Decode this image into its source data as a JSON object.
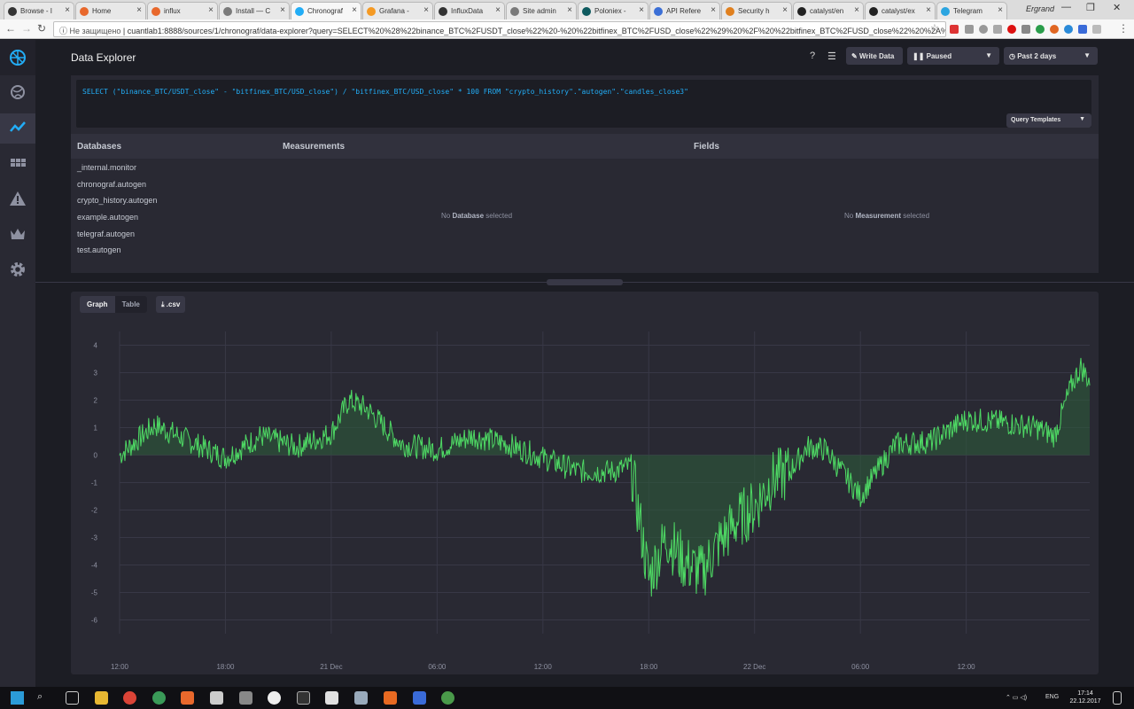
{
  "browser": {
    "tabs": [
      {
        "label": "Browse - I",
        "color": "#333333"
      },
      {
        "label": "Home",
        "color": "#e8682c"
      },
      {
        "label": "influx",
        "color": "#e8682c"
      },
      {
        "label": "Install — C",
        "color": "#7a7a7a"
      },
      {
        "label": "Chronograf",
        "color": "#22adf6"
      },
      {
        "label": "Grafana -",
        "color": "#f59a23"
      },
      {
        "label": "InfluxData",
        "color": "#333333"
      },
      {
        "label": "Site admin",
        "color": "#7a7a7a"
      },
      {
        "label": "Poloniex -",
        "color": "#0e5a5f"
      },
      {
        "label": "API Refere",
        "color": "#3b6fd6"
      },
      {
        "label": "Security h",
        "color": "#e0801f"
      },
      {
        "label": "catalyst/en",
        "color": "#222222"
      },
      {
        "label": "catalyst/ex",
        "color": "#222222"
      },
      {
        "label": "Telegram",
        "color": "#2ca5e0"
      }
    ],
    "active_tab": 4,
    "profile": "Ergrand",
    "url_security": "Не защищено",
    "url": "cuantlab1:8888/sources/1/chronograf/data-explorer?query=SELECT%20%28%22binance_BTC%2FUSDT_close%22%20-%20%22bitfinex_BTC%2FUSD_close%22%29%20%2F%20%22bitfinex_BTC%2FUSD_close%22%20%2A%20100%20FR..."
  },
  "header": {
    "title": "Data Explorer",
    "write_data_label": "Write Data",
    "paused_label": "Paused",
    "range_label": "Past 2 days"
  },
  "query": {
    "text": "SELECT (\"binance_BTC/USDT_close\" - \"bitfinex_BTC/USD_close\") / \"bitfinex_BTC/USD_close\" * 100 FROM \"crypto_history\".\"autogen\".\"candles_close3\"",
    "templates_label": "Query Templates"
  },
  "schema": {
    "databases_header": "Databases",
    "measurements_header": "Measurements",
    "fields_header": "Fields",
    "databases": [
      "_internal.monitor",
      "chronograf.autogen",
      "crypto_history.autogen",
      "example.autogen",
      "telegraf.autogen",
      "test.autogen"
    ],
    "measurements_empty_pre": "No ",
    "measurements_empty_bold": "Database",
    "measurements_empty_post": " selected",
    "fields_empty_pre": "No ",
    "fields_empty_bold": "Measurement",
    "fields_empty_post": " selected"
  },
  "graph_controls": {
    "graph_label": "Graph",
    "table_label": "Table",
    "csv_label": ".csv"
  },
  "chart_data": {
    "type": "area",
    "ylim": [
      -6.5,
      4.5
    ],
    "yticks": [
      4,
      3,
      2,
      1,
      0,
      -1,
      -2,
      -3,
      -4,
      -5,
      -6
    ],
    "xticks": [
      "12:00",
      "18:00",
      "21 Dec",
      "06:00",
      "12:00",
      "18:00",
      "22 Dec",
      "06:00",
      "12:00"
    ],
    "x_hours": [
      0,
      55
    ],
    "series": [
      {
        "color": "#4ed964",
        "fill": "#2d5a3a",
        "x": [
          0,
          2,
          4,
          6,
          8,
          10,
          12,
          13,
          14,
          16,
          18,
          20,
          22,
          24,
          26,
          28,
          29,
          30,
          31,
          32,
          33,
          34,
          35,
          36,
          37,
          38,
          39,
          40,
          42,
          44,
          46,
          48,
          50,
          52,
          53,
          54,
          54.5,
          55
        ],
        "y": [
          0,
          1.1,
          0.5,
          -0.1,
          0.7,
          0.3,
          0.8,
          2.0,
          1.7,
          0.4,
          0.2,
          0.7,
          0.4,
          -0.1,
          -0.6,
          -0.6,
          -0.4,
          -4.5,
          -3.0,
          -3.9,
          -4.3,
          -3.2,
          -2.4,
          -1.9,
          -0.9,
          -0.6,
          0.3,
          0.2,
          -1.5,
          0.4,
          0.5,
          1.3,
          1.2,
          1.0,
          0.7,
          2.6,
          3.2,
          2.7
        ],
        "noise": 0.45
      }
    ]
  },
  "taskbar": {
    "lang": "ENG",
    "time": "17:14",
    "date": "22.12.2017"
  }
}
